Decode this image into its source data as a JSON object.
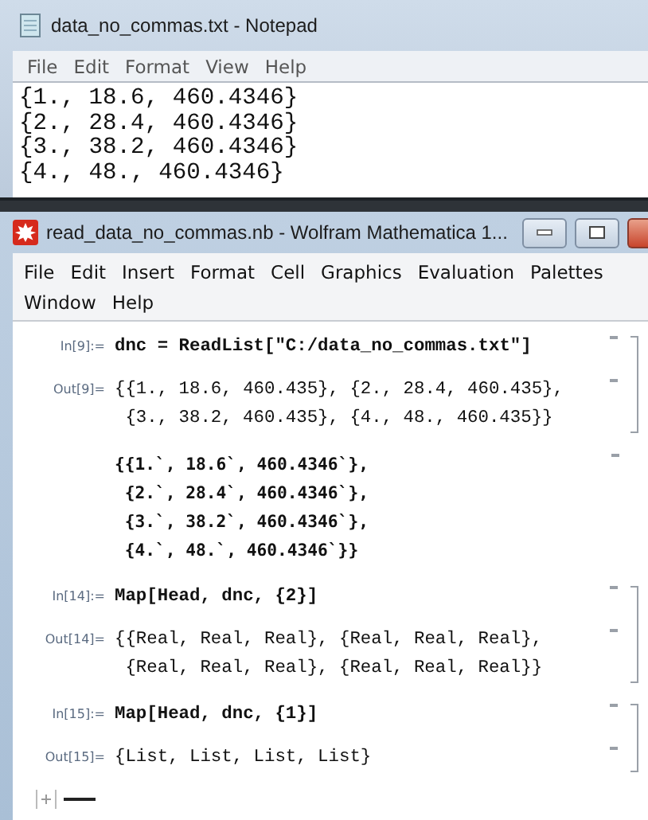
{
  "notepad": {
    "title": "data_no_commas.txt - Notepad",
    "menu": [
      "File",
      "Edit",
      "Format",
      "View",
      "Help"
    ],
    "lines": [
      "{1., 18.6, 460.4346}",
      "{2., 28.4, 460.4346}",
      "{3., 38.2, 460.4346}",
      "{4., 48., 460.4346}"
    ]
  },
  "mathematica": {
    "title": "read_data_no_commas.nb - Wolfram Mathematica 1...",
    "menu_rows": [
      {
        "items": [
          "File",
          "Edit",
          "Insert",
          "Format",
          "Cell",
          "Graphics",
          "Evaluation",
          "Palettes"
        ]
      },
      {
        "items": [
          "Window",
          "Help"
        ]
      }
    ],
    "groups": [
      {
        "cells": [
          {
            "kind": "input",
            "label": "In[9]:=",
            "lines": [
              "dnc = ReadList[\"C:/data_no_commas.txt\"]"
            ]
          },
          {
            "kind": "output",
            "label": "Out[9]=",
            "lines": [
              "{{1., 18.6, 460.435}, {2., 28.4, 460.435},",
              "{3., 38.2, 460.435}, {4., 48., 460.435}}"
            ]
          }
        ]
      },
      {
        "cells": [
          {
            "kind": "plain",
            "lines": [
              "{{1.`, 18.6`, 460.4346`},",
              "{2.`, 28.4`, 460.4346`},",
              "{3.`, 38.2`, 460.4346`},",
              "{4.`, 48.`, 460.4346`}}"
            ]
          }
        ]
      },
      {
        "cells": [
          {
            "kind": "input",
            "label": "In[14]:=",
            "lines": [
              "Map[Head, dnc, {2}]"
            ]
          },
          {
            "kind": "output",
            "label": "Out[14]=",
            "lines": [
              "{{Real, Real, Real}, {Real, Real, Real},",
              "{Real, Real, Real}, {Real, Real, Real}}"
            ]
          }
        ]
      },
      {
        "cells": [
          {
            "kind": "input",
            "label": "In[15]:=",
            "lines": [
              "Map[Head, dnc, {1}]"
            ]
          },
          {
            "kind": "output",
            "label": "Out[15]=",
            "lines": [
              "{List, List, List, List}"
            ]
          }
        ]
      }
    ]
  }
}
